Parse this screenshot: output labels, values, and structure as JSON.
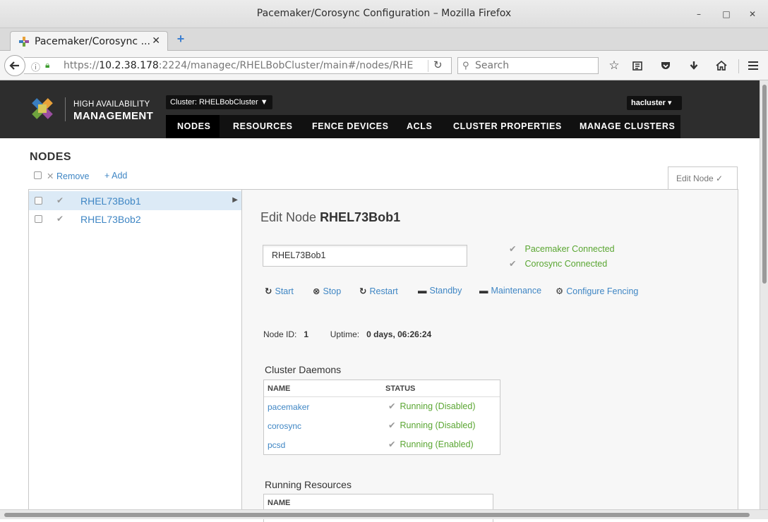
{
  "window": {
    "title": "Pacemaker/Corosync Configuration – Mozilla Firefox",
    "minimize": "–",
    "maximize": "□",
    "close": "✕"
  },
  "tab": {
    "title": "Pacemaker/Corosync ...",
    "close": "✕",
    "new": "+"
  },
  "address": {
    "prefix": "https://",
    "host": "10.2.38.178",
    "rest": ":2224/managec/RHELBobCluster/main#/nodes/RHE",
    "reload": "↻"
  },
  "search": {
    "placeholder": "Search"
  },
  "toolbar_icons": [
    "star-icon",
    "reader-list-icon",
    "pocket-icon",
    "download-icon",
    "home-icon",
    "menu-icon"
  ],
  "app": {
    "brand_line1": "HIGH AVAILABILITY",
    "brand_line2": "MANAGEMENT",
    "cluster_selector": "Cluster: RHELBobCluster ▼",
    "user": "hacluster ▾",
    "nav": [
      "NODES",
      "RESOURCES",
      "FENCE DEVICES",
      "ACLS",
      "CLUSTER PROPERTIES",
      "MANAGE CLUSTERS"
    ],
    "active_nav": "NODES"
  },
  "nodes_page": {
    "title": "NODES",
    "remove_label": "Remove",
    "add_label": "Add",
    "edit_tab": "Edit Node ✓",
    "nodes": [
      {
        "name": "RHEL73Bob1",
        "selected": true
      },
      {
        "name": "RHEL73Bob2",
        "selected": false
      }
    ]
  },
  "detail": {
    "title_prefix": "Edit Node ",
    "title_node": "RHEL73Bob1",
    "name_value": "RHEL73Bob1",
    "status_pacemaker": "Pacemaker Connected",
    "status_corosync": "Corosync Connected",
    "actions": [
      "Start",
      "Stop",
      "Restart",
      "Standby",
      "Maintenance",
      "Configure Fencing"
    ],
    "node_id_label": "Node ID:",
    "node_id": "1",
    "uptime_label": "Uptime:",
    "uptime": "0 days, 06:26:24",
    "daemons_heading": "Cluster Daemons",
    "col_name": "NAME",
    "col_status": "STATUS",
    "daemons": [
      {
        "name": "pacemaker",
        "status": "Running (Disabled)"
      },
      {
        "name": "corosync",
        "status": "Running (Disabled)"
      },
      {
        "name": "pcsd",
        "status": "Running (Enabled)"
      }
    ],
    "resources_heading": "Running Resources",
    "resources_col_name": "NAME"
  },
  "colors": {
    "link": "#3f86c4",
    "ok_green": "#5aa632",
    "header_bg": "#2d2d2d",
    "selected_row": "#dceaf6"
  }
}
